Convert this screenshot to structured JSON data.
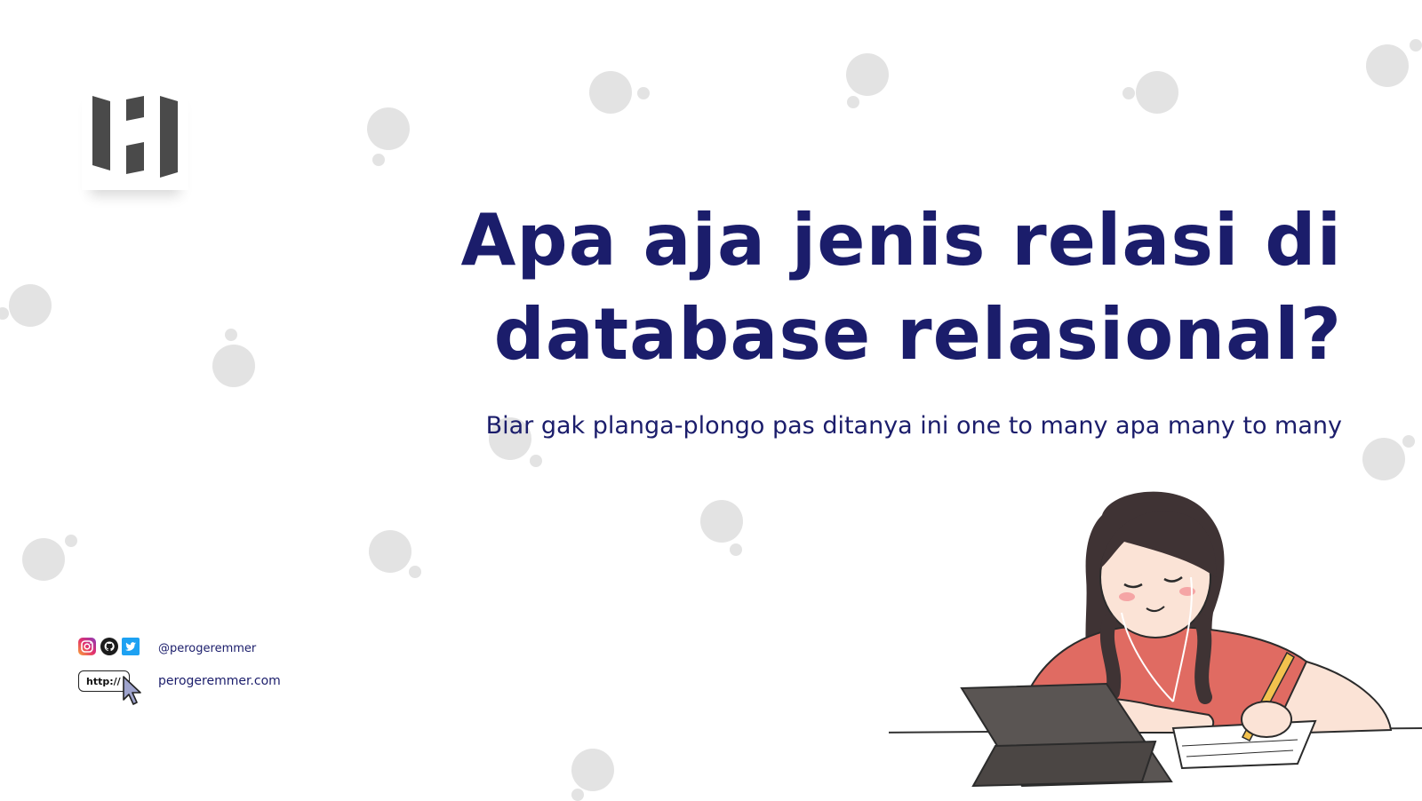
{
  "title": {
    "line1": "Apa aja jenis relasi di",
    "line2": "database relasional?"
  },
  "subtitle": "Biar gak planga-plongo pas ditanya ini one to many apa many to many",
  "social": {
    "icons": [
      "instagram-icon",
      "github-icon",
      "twitter-icon"
    ],
    "handle": "@perogeremmer"
  },
  "website": {
    "badge": "http://",
    "url": "perogeremmer.com"
  },
  "colors": {
    "title": "#1b1d6b",
    "bubble": "#e3e3e3",
    "logo": "#4a4a4a"
  }
}
